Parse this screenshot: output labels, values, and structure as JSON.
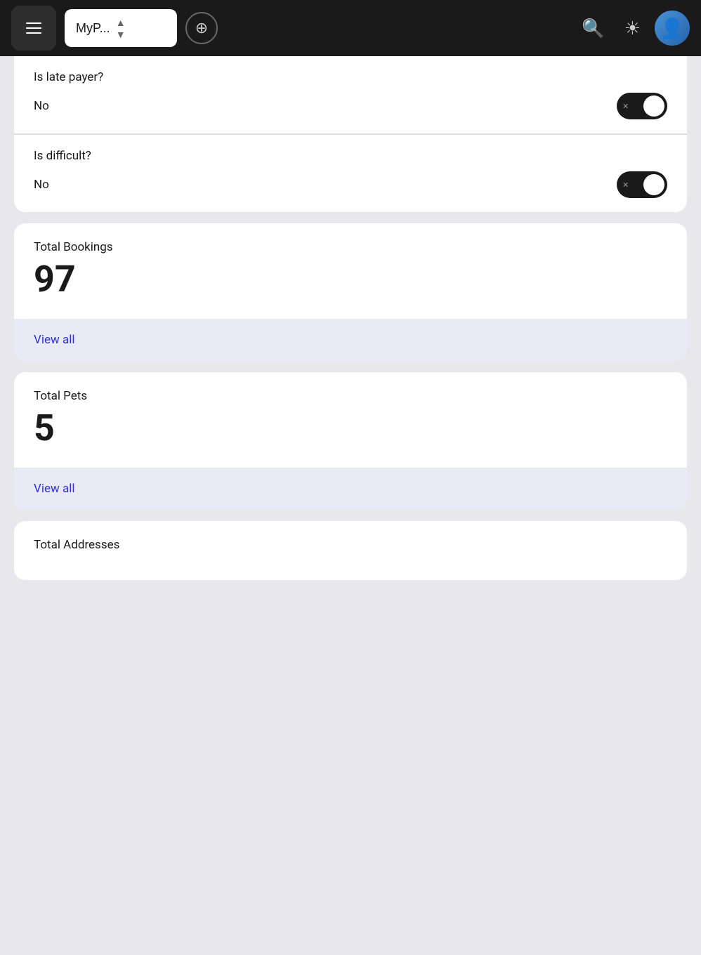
{
  "nav": {
    "menu_label": "Menu",
    "workspace_name": "MyP...",
    "add_label": "+",
    "search_icon": "search-icon",
    "theme_icon": "sun-icon",
    "avatar_icon": "avatar-icon"
  },
  "form_card": {
    "late_payer": {
      "label": "Is late payer?",
      "value": "No",
      "toggled": true
    },
    "difficult": {
      "label": "Is difficult?",
      "value": "No",
      "toggled": true
    }
  },
  "total_bookings": {
    "label": "Total Bookings",
    "value": "97",
    "view_all": "View all"
  },
  "total_pets": {
    "label": "Total Pets",
    "value": "5",
    "view_all": "View all"
  },
  "total_addresses": {
    "label": "Total Addresses"
  }
}
